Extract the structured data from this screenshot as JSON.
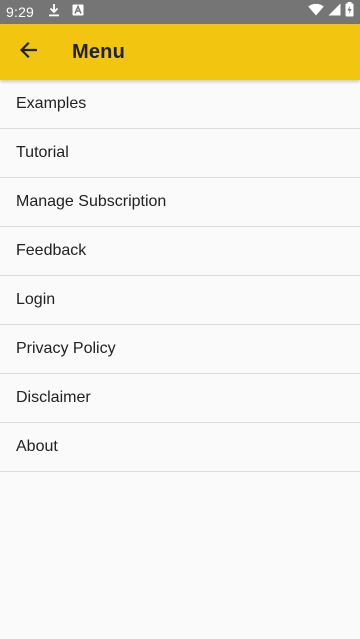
{
  "status_bar": {
    "time": "9:29",
    "icons": [
      "download-icon",
      "notification-a-icon",
      "wifi-icon",
      "signal-icon",
      "battery-charging-icon"
    ]
  },
  "app_bar": {
    "title": "Menu",
    "back_icon": "arrow-back-icon",
    "color": "#f2c511"
  },
  "menu": {
    "items": [
      {
        "label": "Examples"
      },
      {
        "label": "Tutorial"
      },
      {
        "label": "Manage Subscription"
      },
      {
        "label": "Feedback"
      },
      {
        "label": "Login"
      },
      {
        "label": "Privacy Policy"
      },
      {
        "label": "Disclaimer"
      },
      {
        "label": "About"
      }
    ]
  }
}
